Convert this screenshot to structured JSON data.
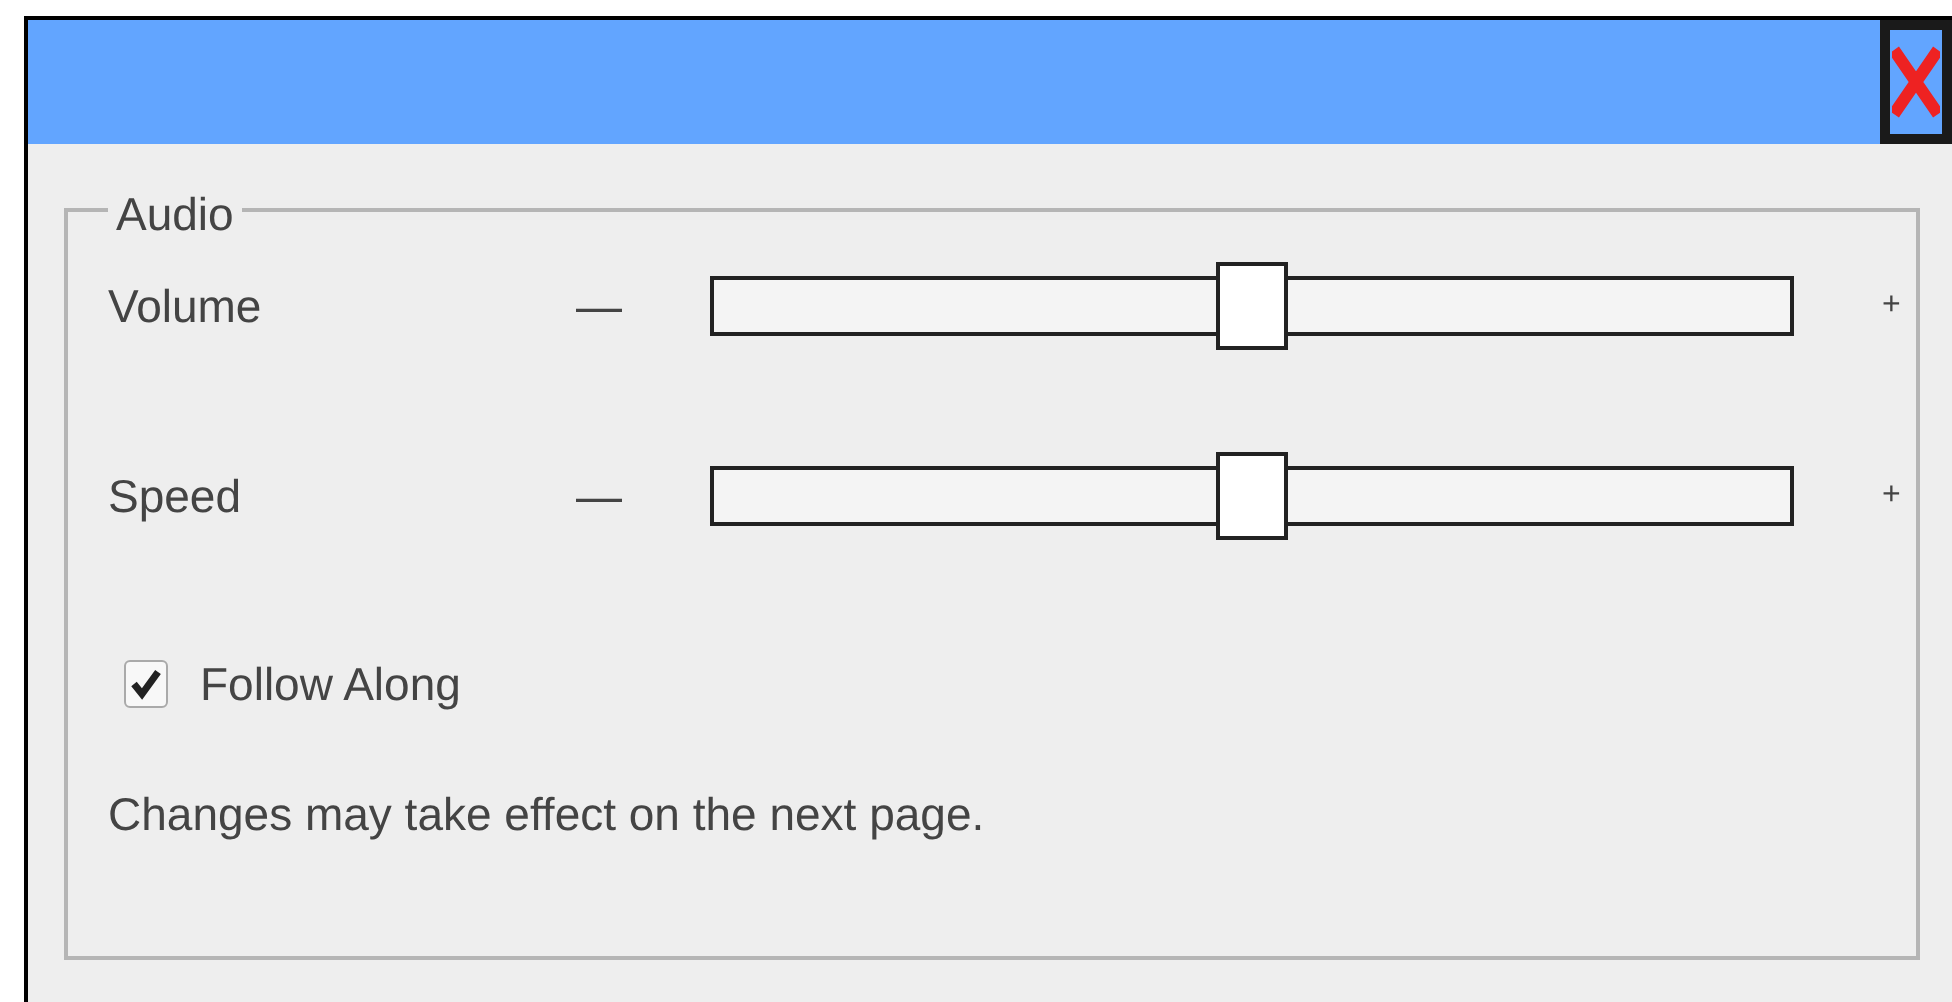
{
  "dialog": {
    "group": {
      "legend": "Audio",
      "sliders": [
        {
          "label": "Volume",
          "decrease": "—",
          "increase": "+",
          "level": 0.5
        },
        {
          "label": "Speed",
          "decrease": "—",
          "increase": "+",
          "level": 0.5
        }
      ],
      "checkbox": {
        "label": "Follow Along",
        "checked": true
      },
      "note": "Changes may take effect on the next page."
    }
  }
}
